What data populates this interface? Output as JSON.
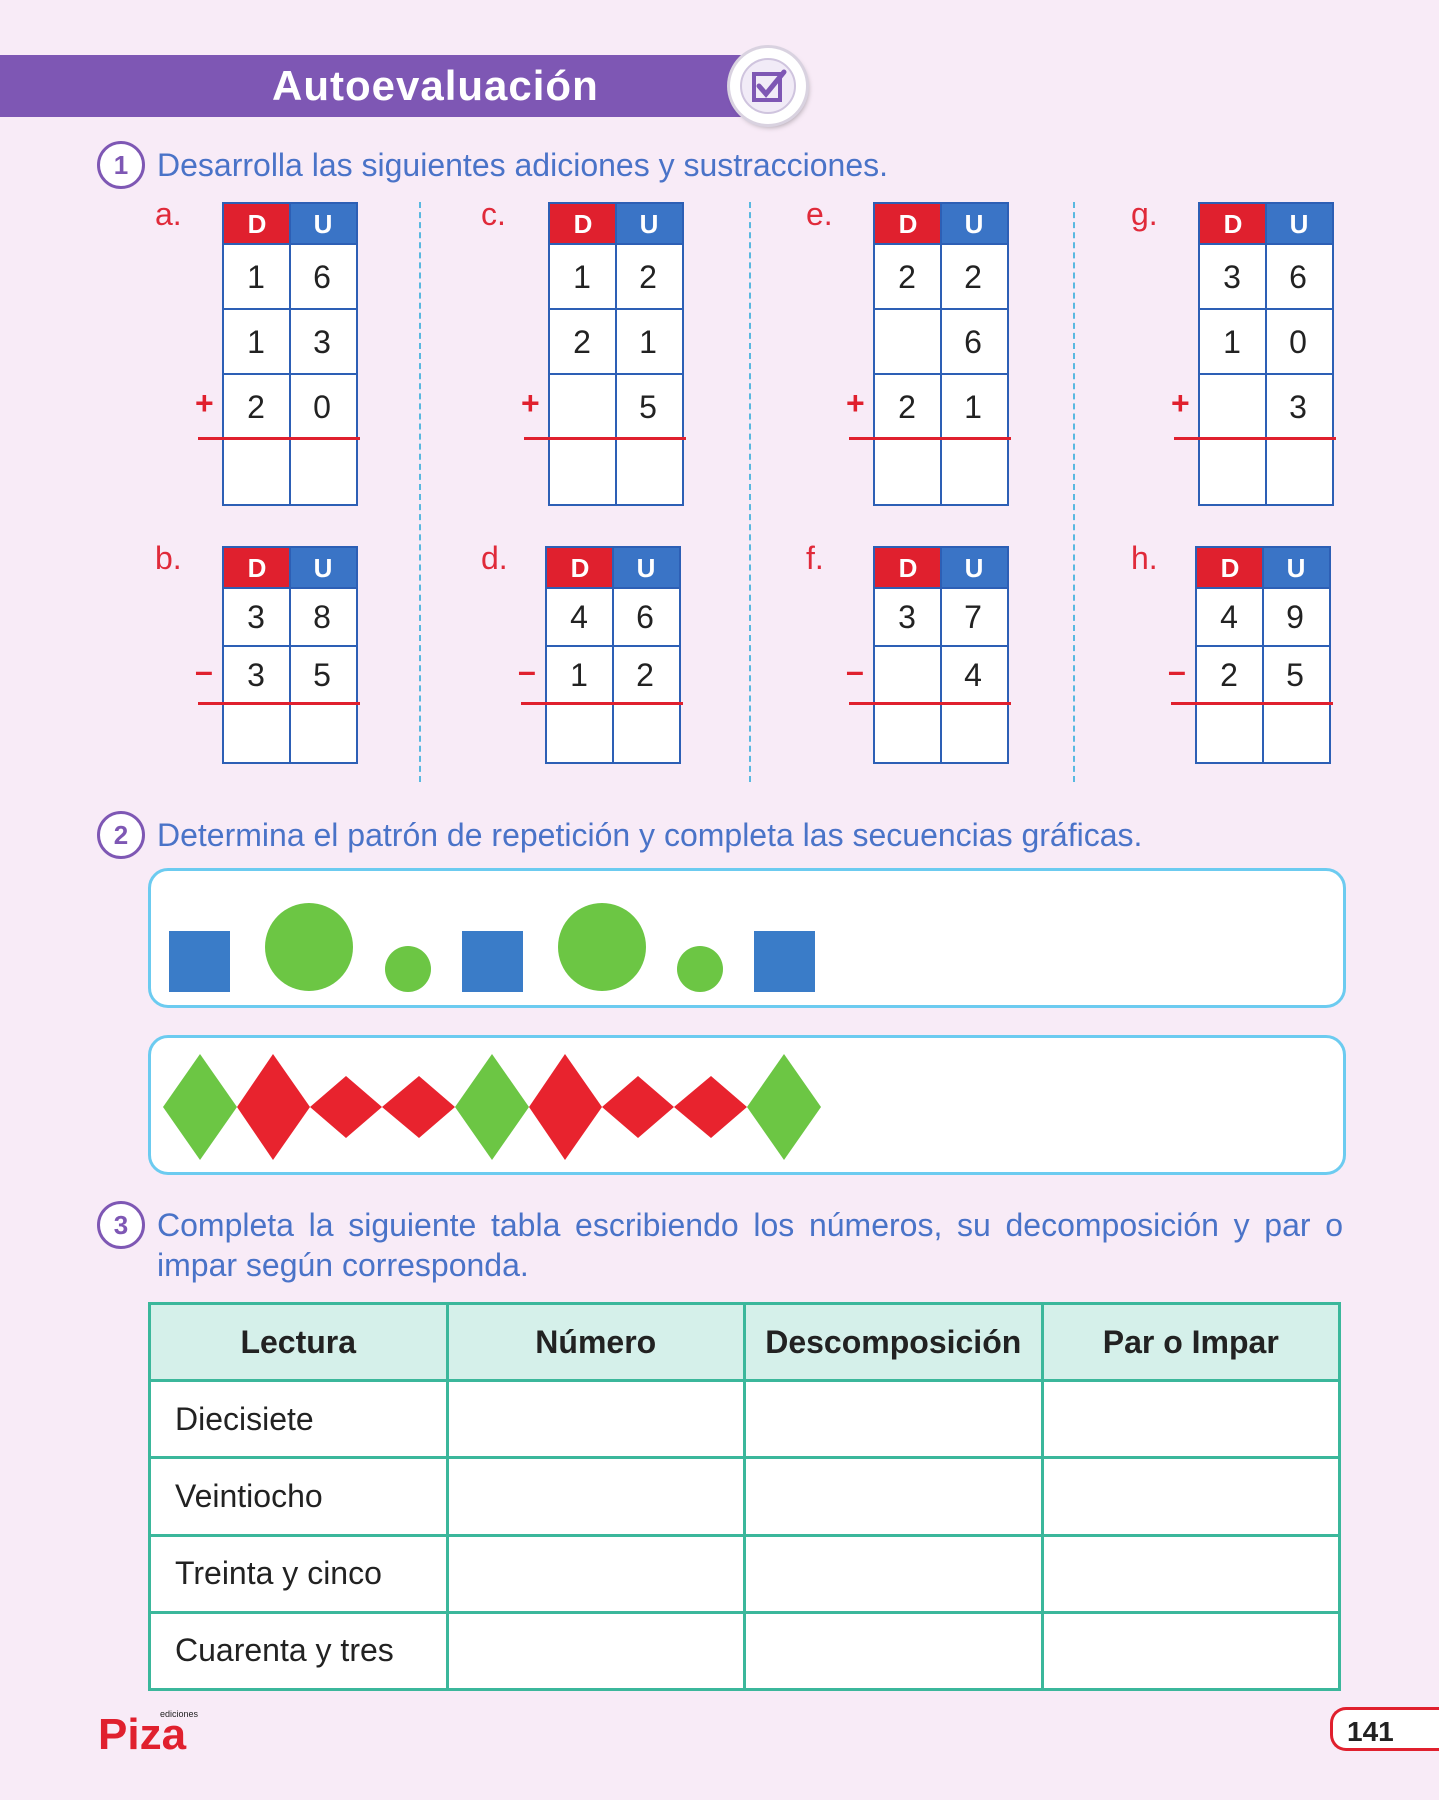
{
  "header": {
    "title": "Autoevaluación",
    "badge_icon": "checkbox-check-icon"
  },
  "q1": {
    "number": "1",
    "text": "Desarrolla las siguientes adiciones y sustracciones.",
    "col_d": "D",
    "col_u": "U",
    "problems": [
      {
        "label": "a.",
        "op": "+",
        "rows": [
          [
            "1",
            "6"
          ],
          [
            "1",
            "3"
          ],
          [
            "2",
            "0"
          ]
        ]
      },
      {
        "label": "c.",
        "op": "+",
        "rows": [
          [
            "1",
            "2"
          ],
          [
            "2",
            "1"
          ],
          [
            "",
            "5"
          ]
        ]
      },
      {
        "label": "e.",
        "op": "+",
        "rows": [
          [
            "2",
            "2"
          ],
          [
            "",
            "6"
          ],
          [
            "2",
            "1"
          ]
        ]
      },
      {
        "label": "g.",
        "op": "+",
        "rows": [
          [
            "3",
            "6"
          ],
          [
            "1",
            "0"
          ],
          [
            "",
            "3"
          ]
        ]
      },
      {
        "label": "b.",
        "op": "–",
        "rows": [
          [
            "3",
            "8"
          ],
          [
            "3",
            "5"
          ]
        ]
      },
      {
        "label": "d.",
        "op": "–",
        "rows": [
          [
            "4",
            "6"
          ],
          [
            "1",
            "2"
          ]
        ]
      },
      {
        "label": "f.",
        "op": "–",
        "rows": [
          [
            "3",
            "7"
          ],
          [
            "",
            "4"
          ]
        ]
      },
      {
        "label": "h.",
        "op": "–",
        "rows": [
          [
            "4",
            "9"
          ],
          [
            "2",
            "5"
          ]
        ]
      }
    ]
  },
  "q2": {
    "number": "2",
    "text": "Determina el patrón de repetición y completa las secuencias gráficas.",
    "sequence_1": [
      "blue-square",
      "big-green-circle",
      "small-green-circle",
      "blue-square",
      "big-green-circle",
      "small-green-circle",
      "blue-square"
    ],
    "sequence_2": [
      "big-green-diamond",
      "big-red-diamond",
      "small-red-diamond",
      "small-red-diamond",
      "big-green-diamond",
      "big-red-diamond",
      "small-red-diamond",
      "small-red-diamond",
      "big-green-diamond"
    ]
  },
  "q3": {
    "number": "3",
    "text": "Completa la siguiente tabla escribiendo los números, su decomposición y par o impar según corresponda.",
    "headers": [
      "Lectura",
      "Número",
      "Descomposición",
      "Par o Impar"
    ],
    "rows": [
      "Diecisiete",
      "Veintiocho",
      "Treinta y cinco",
      "Cuarenta y tres"
    ]
  },
  "footer": {
    "logo_word": "Piza",
    "logo_small": "ediciones",
    "page": "141"
  },
  "colors": {
    "accent_purple": "#7e57b4",
    "blue": "#3a74c6",
    "red": "#e0202e",
    "green": "#6cc644",
    "teal": "#3bb79b"
  }
}
